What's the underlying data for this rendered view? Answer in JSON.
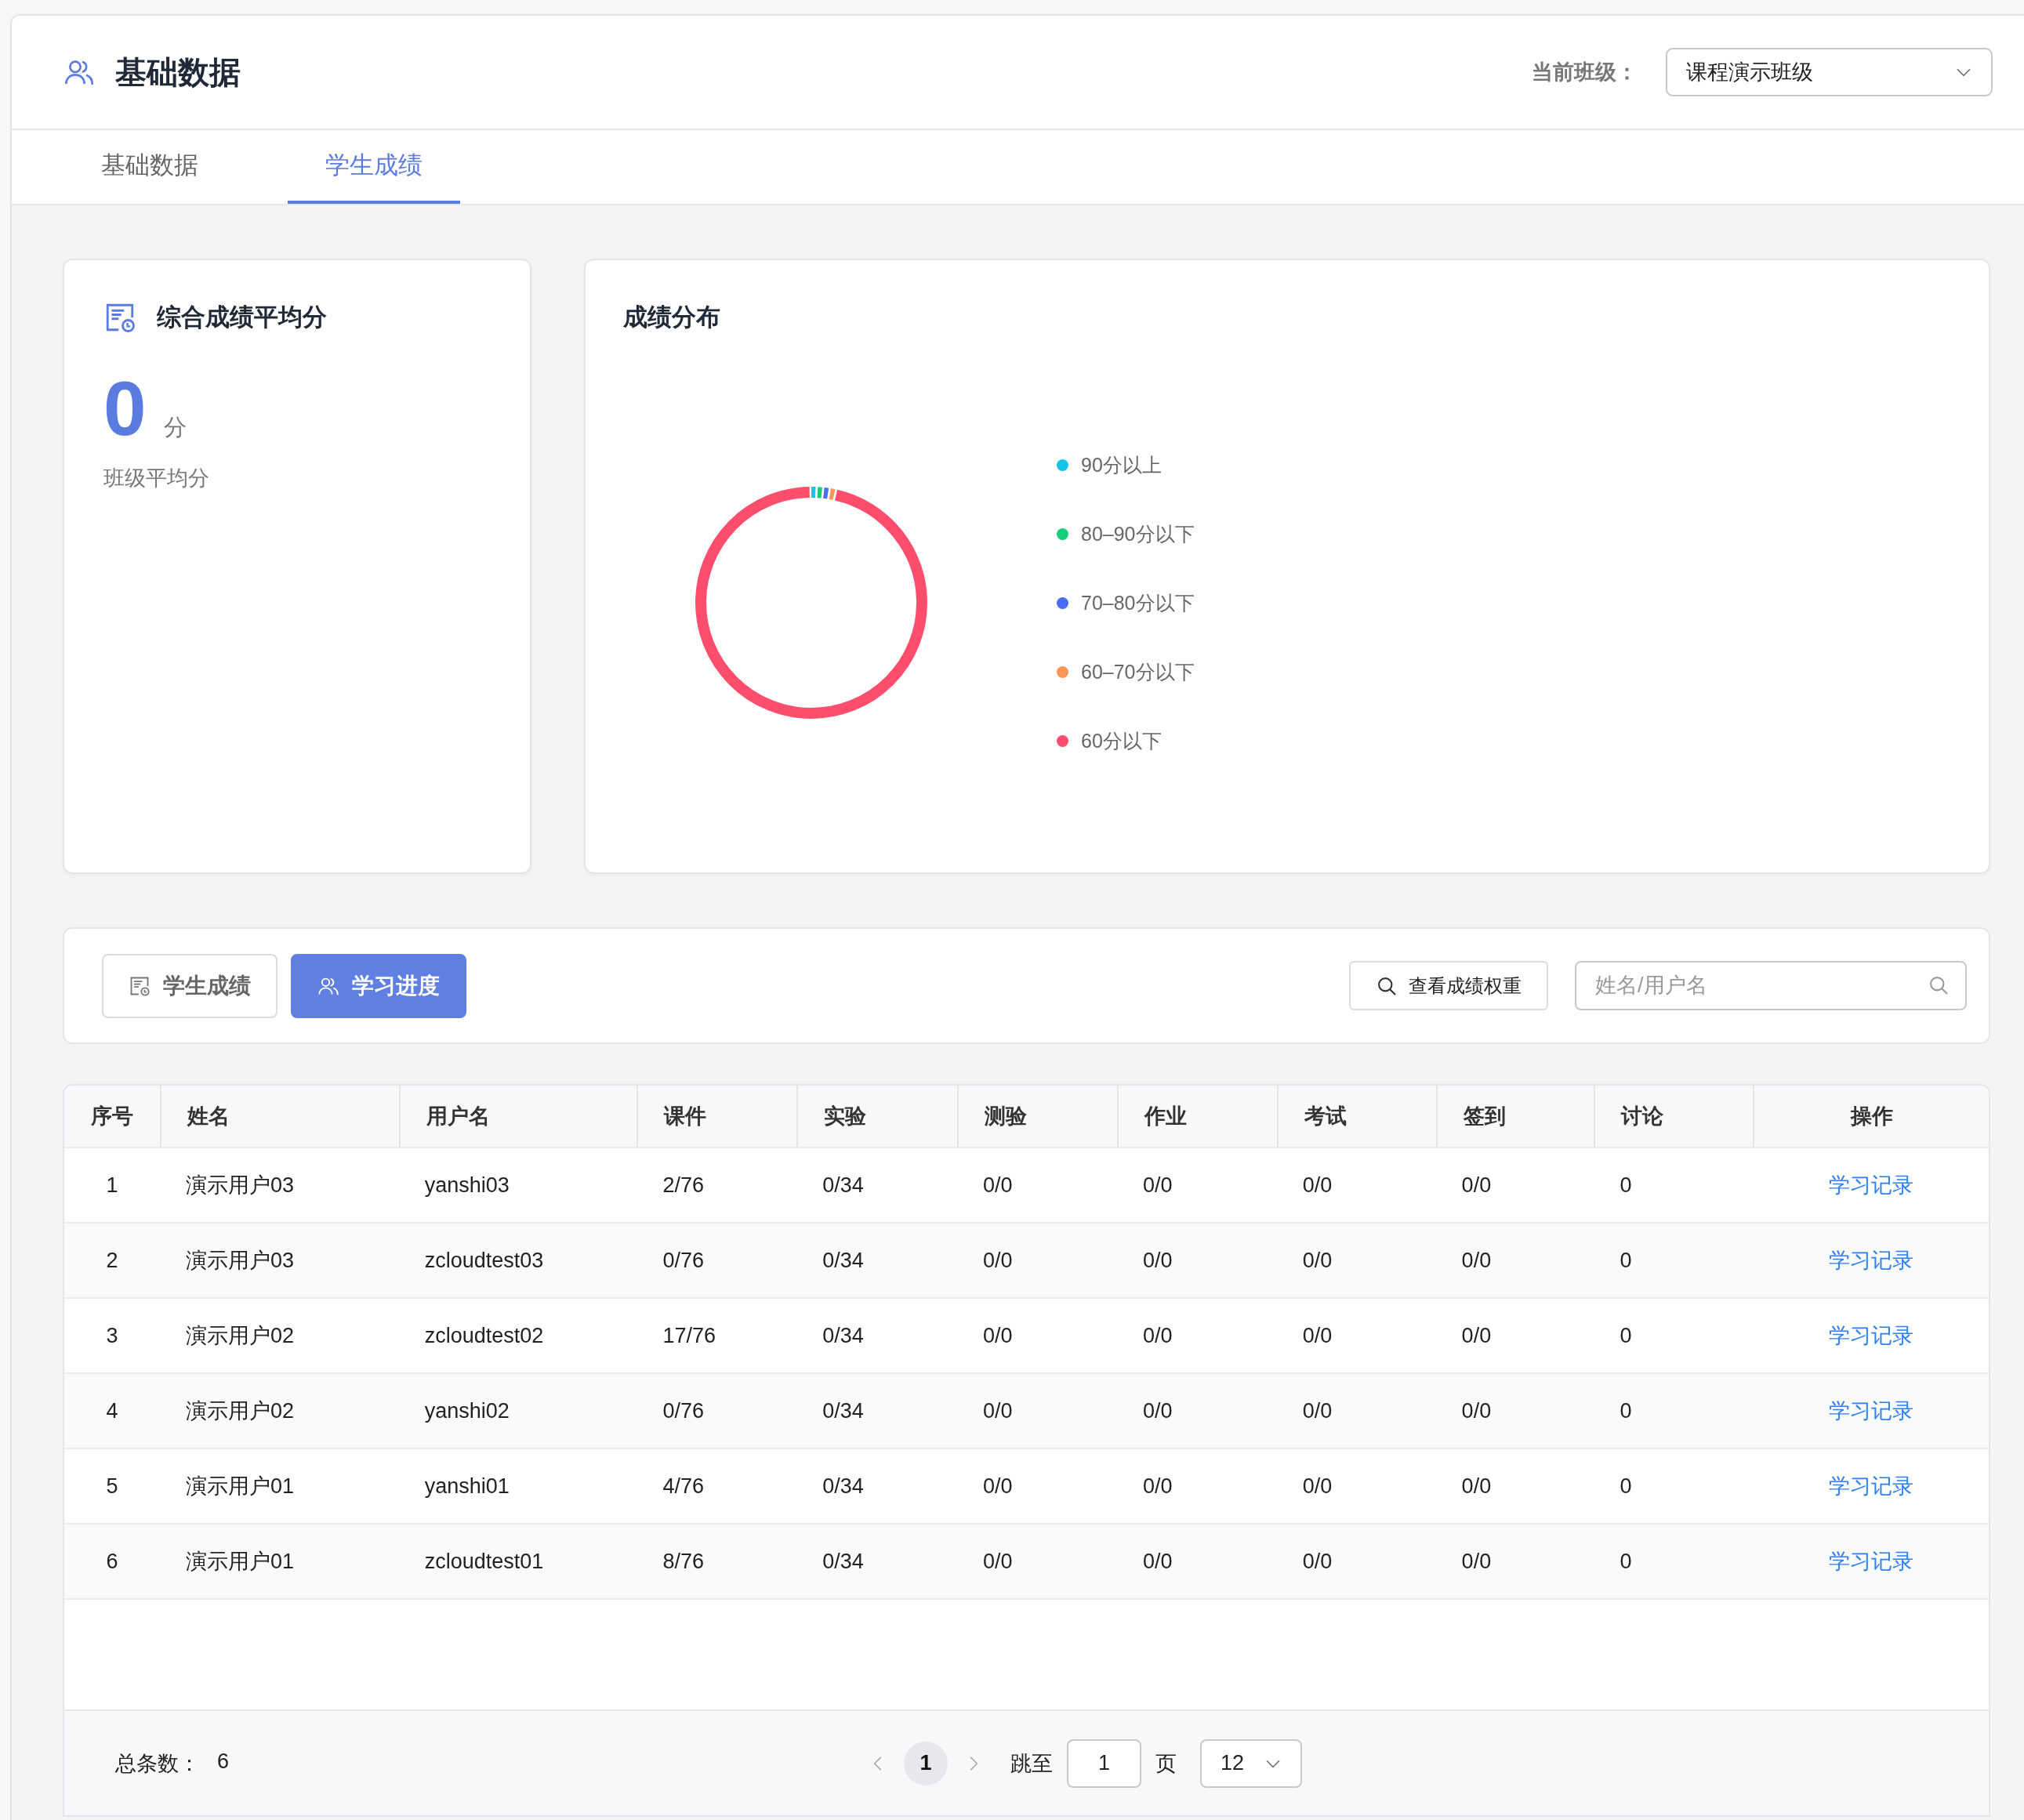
{
  "header": {
    "title": "基础数据",
    "class_label": "当前班级：",
    "class_select": {
      "value": "课程演示班级"
    }
  },
  "tabs": [
    {
      "label": "基础数据",
      "selected": false
    },
    {
      "label": "学生成绩",
      "selected": true
    }
  ],
  "average_card": {
    "title": "综合成绩平均分",
    "score": "0",
    "unit": "分",
    "caption": "班级平均分"
  },
  "distribution_card": {
    "title": "成绩分布",
    "legend": [
      {
        "label": "90分以上",
        "color": "#17c3e6"
      },
      {
        "label": "80–90分以下",
        "color": "#13cf7a"
      },
      {
        "label": "70–80分以下",
        "color": "#4a6cf0"
      },
      {
        "label": "60–70分以下",
        "color": "#ff9457"
      },
      {
        "label": "60分以下",
        "color": "#ff4d6e"
      }
    ]
  },
  "toolbar": {
    "view_buttons": [
      {
        "label": "学生成绩",
        "selected": false
      },
      {
        "label": "学习进度",
        "selected": true
      }
    ],
    "weight_button": "查看成绩权重",
    "search": {
      "placeholder": "姓名/用户名"
    }
  },
  "table": {
    "columns": [
      "序号",
      "姓名",
      "用户名",
      "课件",
      "实验",
      "测验",
      "作业",
      "考试",
      "签到",
      "讨论",
      "操作"
    ],
    "rows": [
      [
        "1",
        "演示用户03",
        "yanshi03",
        "2/76",
        "0/34",
        "0/0",
        "0/0",
        "0/0",
        "0/0",
        "0",
        "学习记录"
      ],
      [
        "2",
        "演示用户03",
        "zcloudtest03",
        "0/76",
        "0/34",
        "0/0",
        "0/0",
        "0/0",
        "0/0",
        "0",
        "学习记录"
      ],
      [
        "3",
        "演示用户02",
        "zcloudtest02",
        "17/76",
        "0/34",
        "0/0",
        "0/0",
        "0/0",
        "0/0",
        "0",
        "学习记录"
      ],
      [
        "4",
        "演示用户02",
        "yanshi02",
        "0/76",
        "0/34",
        "0/0",
        "0/0",
        "0/0",
        "0/0",
        "0",
        "学习记录"
      ],
      [
        "5",
        "演示用户01",
        "yanshi01",
        "4/76",
        "0/34",
        "0/0",
        "0/0",
        "0/0",
        "0/0",
        "0",
        "学习记录"
      ],
      [
        "6",
        "演示用户01",
        "zcloudtest01",
        "8/76",
        "0/34",
        "0/0",
        "0/0",
        "0/0",
        "0/0",
        "0",
        "学习记录"
      ]
    ]
  },
  "pagination": {
    "total_label": "总条数：",
    "total": "6",
    "pages": [
      {
        "label": "1",
        "selected": true
      }
    ],
    "jump_label": "跳至",
    "jump_value": "1",
    "page_unit": "页",
    "page_size": "12"
  }
}
